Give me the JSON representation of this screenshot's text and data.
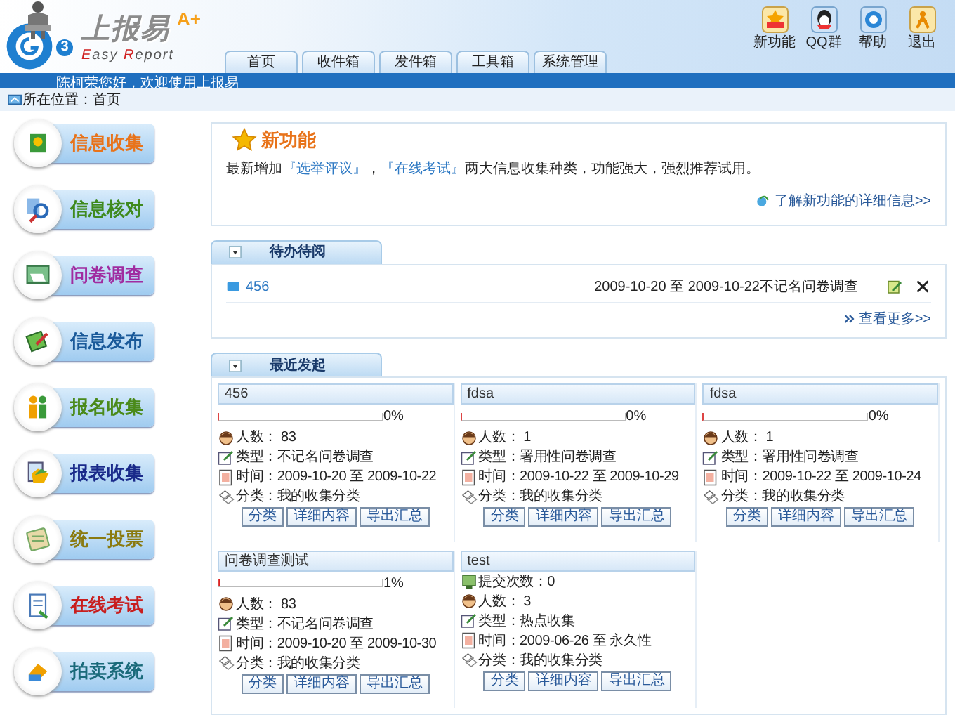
{
  "logo": {
    "title": "上报易",
    "title_mark": "A+",
    "subtitle": [
      {
        "text": "E",
        "accent": true
      },
      {
        "text": "asy ",
        "accent": false
      },
      {
        "text": "R",
        "accent": true
      },
      {
        "text": "eport",
        "accent": false
      }
    ],
    "badge": "3"
  },
  "tabs": [
    {
      "label": "首页",
      "selected": false
    },
    {
      "label": "收件箱",
      "selected": false
    },
    {
      "label": "发件箱",
      "selected": false
    },
    {
      "label": "工具箱",
      "selected": false
    },
    {
      "label": "系统管理",
      "selected": false
    }
  ],
  "header_buttons": [
    {
      "label": "新功能",
      "kind": "new"
    },
    {
      "label": "QQ群",
      "kind": "qq"
    },
    {
      "label": "帮助",
      "kind": "help"
    },
    {
      "label": "退出",
      "kind": "exit"
    }
  ],
  "greeting": "陈柯荣您好，欢迎使用上报易",
  "breadcrumb": "所在位置：首页",
  "sidebar": [
    {
      "label": "信息收集",
      "color": "#e8731a"
    },
    {
      "label": "信息核对",
      "color": "#3f8a1e"
    },
    {
      "label": "问卷调查",
      "color": "#a02ca0"
    },
    {
      "label": "信息发布",
      "color": "#1a5a9a"
    },
    {
      "label": "报名收集",
      "color": "#4a8a1a"
    },
    {
      "label": "报表收集",
      "color": "#1a2a8a"
    },
    {
      "label": "统一投票",
      "color": "#8a7a10"
    },
    {
      "label": "在线考试",
      "color": "#c81e1e"
    },
    {
      "label": "拍卖系统",
      "color": "#1a6a7a"
    }
  ],
  "news": {
    "title": "新功能",
    "text": [
      {
        "text": "最新增加",
        "link": false
      },
      {
        "text": "『选举评议』",
        "link": true
      },
      {
        "text": "，",
        "link": false
      },
      {
        "text": "『在线考试』",
        "link": true
      },
      {
        "text": "两大信息收集种类，功能强大，强烈推荐试用。",
        "link": false
      }
    ],
    "more": "了解新功能的详细信息>>"
  },
  "todo": {
    "title": "待办待阅",
    "items": [
      {
        "name": "456",
        "detail": "2009-10-20 至 2009-10-22不记名问卷调查"
      }
    ],
    "more": "查看更多>>"
  },
  "recent": {
    "title": "最近发起",
    "cards": [
      {
        "title": "456",
        "level": 0,
        "percent": "0%",
        "rows": [
          {
            "kind": "people",
            "text": "人数： 83"
          },
          {
            "kind": "type",
            "text": "类型：不记名问卷调查"
          },
          {
            "kind": "time",
            "text": "时间：2009-10-20 至 2009-10-22"
          },
          {
            "kind": "category",
            "text": "分类：我的收集分类"
          }
        ],
        "buttons": [
          "分类",
          "详细内容",
          "导出汇总"
        ]
      },
      {
        "title": "fdsa",
        "level": 0,
        "percent": "0%",
        "rows": [
          {
            "kind": "people",
            "text": "人数： 1"
          },
          {
            "kind": "type",
            "text": "类型：署用性问卷调查"
          },
          {
            "kind": "time",
            "text": "时间：2009-10-22 至 2009-10-29"
          },
          {
            "kind": "category",
            "text": "分类：我的收集分类"
          }
        ],
        "buttons": [
          "分类",
          "详细内容",
          "导出汇总"
        ]
      },
      {
        "title": "fdsa",
        "level": 0,
        "percent": "0%",
        "rows": [
          {
            "kind": "people",
            "text": "人数： 1"
          },
          {
            "kind": "type",
            "text": "类型：署用性问卷调查"
          },
          {
            "kind": "time",
            "text": "时间：2009-10-22 至 2009-10-24"
          },
          {
            "kind": "category",
            "text": "分类：我的收集分类"
          }
        ],
        "buttons": [
          "分类",
          "详细内容",
          "导出汇总"
        ]
      },
      {
        "title": "问卷调查测试",
        "level": 0.01,
        "percent": "1%",
        "rows": [
          {
            "kind": "people",
            "text": "人数： 83"
          },
          {
            "kind": "type",
            "text": "类型：不记名问卷调查"
          },
          {
            "kind": "time",
            "text": "时间：2009-10-20 至 2009-10-30"
          },
          {
            "kind": "category",
            "text": "分类：我的收集分类"
          }
        ],
        "buttons": [
          "分类",
          "详细内容",
          "导出汇总"
        ]
      },
      {
        "title": "test",
        "rows": [
          {
            "kind": "submissions",
            "text": "提交次数：0"
          },
          {
            "kind": "people",
            "text": "人数： 3"
          },
          {
            "kind": "type",
            "text": "类型：热点收集"
          },
          {
            "kind": "time",
            "text": "时间：2009-06-26 至 永久性"
          },
          {
            "kind": "category",
            "text": "分类：我的收集分类"
          }
        ],
        "buttons": [
          "分类",
          "详细内容",
          "导出汇总"
        ]
      }
    ]
  }
}
